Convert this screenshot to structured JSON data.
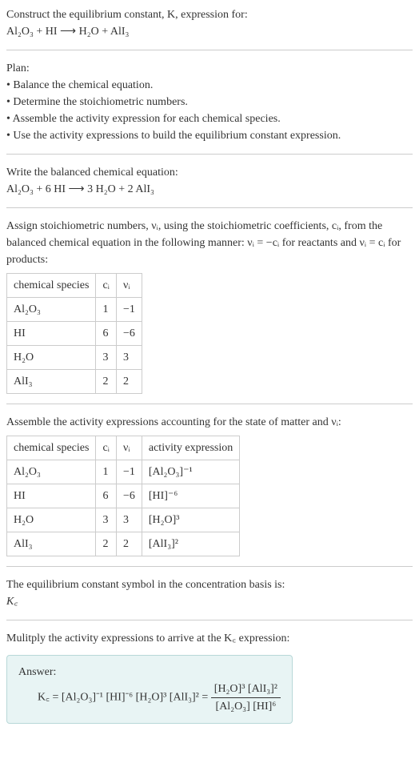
{
  "title_line1": "Construct the equilibrium constant, K, expression for:",
  "title_line2": "Al₂O₃ + HI ⟶ H₂O + AlI₃",
  "plan_heading": "Plan:",
  "plan_items": [
    "• Balance the chemical equation.",
    "• Determine the stoichiometric numbers.",
    "• Assemble the activity expression for each chemical species.",
    "• Use the activity expressions to build the equilibrium constant expression."
  ],
  "balanced_heading": "Write the balanced chemical equation:",
  "balanced_equation": "Al₂O₃ + 6 HI ⟶ 3 H₂O + 2 AlI₃",
  "stoich_intro": "Assign stoichiometric numbers, νᵢ, using the stoichiometric coefficients, cᵢ, from the balanced chemical equation in the following manner: νᵢ = −cᵢ for reactants and νᵢ = cᵢ for products:",
  "table1": {
    "headers": [
      "chemical species",
      "cᵢ",
      "νᵢ"
    ],
    "rows": [
      [
        "Al₂O₃",
        "1",
        "−1"
      ],
      [
        "HI",
        "6",
        "−6"
      ],
      [
        "H₂O",
        "3",
        "3"
      ],
      [
        "AlI₃",
        "2",
        "2"
      ]
    ]
  },
  "activity_intro": "Assemble the activity expressions accounting for the state of matter and νᵢ:",
  "table2": {
    "headers": [
      "chemical species",
      "cᵢ",
      "νᵢ",
      "activity expression"
    ],
    "rows": [
      [
        "Al₂O₃",
        "1",
        "−1",
        "[Al₂O₃]⁻¹"
      ],
      [
        "HI",
        "6",
        "−6",
        "[HI]⁻⁶"
      ],
      [
        "H₂O",
        "3",
        "3",
        "[H₂O]³"
      ],
      [
        "AlI₃",
        "2",
        "2",
        "[AlI₃]²"
      ]
    ]
  },
  "symbol_line1": "The equilibrium constant symbol in the concentration basis is:",
  "symbol_line2": "K꜀",
  "multiply_line": "Mulitply the activity expressions to arrive at the K꜀ expression:",
  "answer_label": "Answer:",
  "answer_lhs": "K꜀ = [Al₂O₃]⁻¹ [HI]⁻⁶ [H₂O]³ [AlI₃]² = ",
  "answer_num": "[H₂O]³ [AlI₃]²",
  "answer_den": "[Al₂O₃] [HI]⁶"
}
